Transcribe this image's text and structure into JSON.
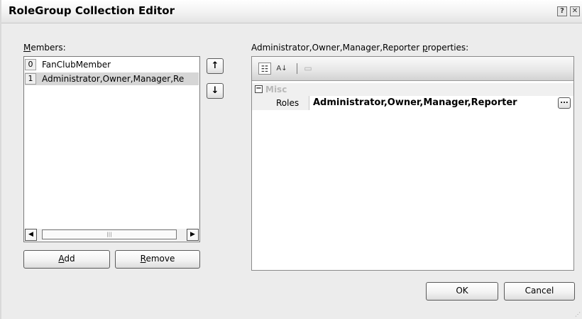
{
  "window": {
    "title": "RoleGroup Collection Editor",
    "help_glyph": "?",
    "close_glyph": "✕"
  },
  "members": {
    "label_prefix": "",
    "label_mnemonic": "M",
    "label_rest": "embers:",
    "items": [
      {
        "index": "0",
        "text": "FanClubMember"
      },
      {
        "index": "1",
        "text": "Administrator,Owner,Manager,Re"
      }
    ],
    "scroll_left_glyph": "◀",
    "scroll_right_glyph": "▶",
    "thumb_glyph": "|||"
  },
  "order_buttons": {
    "up_glyph": "↑",
    "down_glyph": "↓"
  },
  "actions": {
    "add_prefix": "",
    "add_mnemonic": "A",
    "add_rest": "dd",
    "remove_prefix": "",
    "remove_mnemonic": "R",
    "remove_rest": "emove"
  },
  "properties": {
    "label_prefix": "Administrator,Owner,Manager,Reporter ",
    "label_mnemonic": "p",
    "label_rest": "roperties:",
    "toolbar": {
      "categorized_icon": "☷",
      "alphabetical_icon": "A↓",
      "pages_icon": "▭"
    },
    "category": {
      "expander_glyph": "−",
      "name": "Misc"
    },
    "rows": [
      {
        "name": "Roles",
        "value": "Administrator,Owner,Manager,Reporter",
        "ellipsis": "..."
      }
    ]
  },
  "footer": {
    "ok_label": "OK",
    "cancel_label": "Cancel",
    "grip_glyph": "⋰"
  }
}
